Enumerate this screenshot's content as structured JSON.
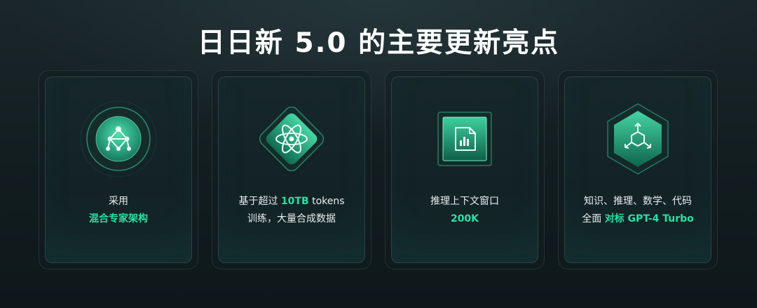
{
  "title": "日日新 5.0 的主要更新亮点",
  "colors": {
    "accent": "#27e0a4",
    "background": "#121d20",
    "text": "#e9eeee"
  },
  "cards": [
    {
      "icon": "network-nodes-icon",
      "line1": "采用",
      "line2_highlight": "混合专家架构"
    },
    {
      "icon": "atom-icon",
      "line1_pre": "基于超过 ",
      "line1_highlight": "10TB",
      "line1_post": " tokens",
      "line2": "训练，大量合成数据"
    },
    {
      "icon": "document-chart-icon",
      "line1": "推理上下文窗口",
      "line2_highlight": "200K"
    },
    {
      "icon": "cube-arrows-icon",
      "line1": "知识、推理、数学、代码",
      "line2_pre": "全面 ",
      "line2_highlight": "对标 GPT-4 Turbo"
    }
  ]
}
